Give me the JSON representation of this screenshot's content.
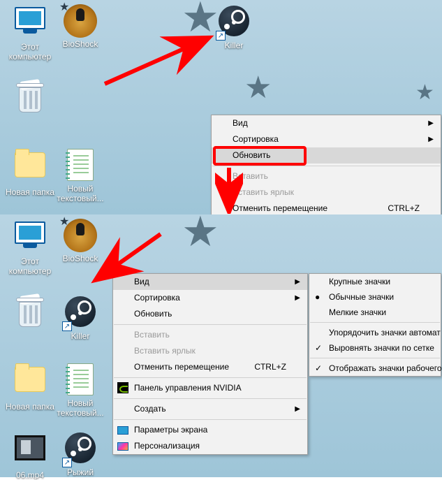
{
  "top": {
    "icons": {
      "pc": "Этот компьютер",
      "bioshock": "BioShock",
      "killer": "Killer",
      "newfolder": "Новая папка",
      "newtxt": "Новый текстовый..."
    },
    "menu": {
      "view": "Вид",
      "sort": "Сортировка",
      "refresh": "Обновить",
      "paste": "Вставить",
      "paste_shortcut": "Вставить ярлык",
      "undo_move": "Отменить перемещение",
      "undo_key": "CTRL+Z"
    }
  },
  "bottom": {
    "icons": {
      "pc": "Этот компьютер",
      "bioshock": "BioShock",
      "killer": "Killer",
      "newfolder": "Новая папка",
      "newtxt": "Новый текстовый...",
      "video": "06.mp4",
      "ryzhiy": "Рыжий"
    },
    "menu": {
      "view": "Вид",
      "sort": "Сортировка",
      "refresh": "Обновить",
      "paste": "Вставить",
      "paste_shortcut": "Вставить ярлык",
      "undo_move": "Отменить перемещение",
      "undo_key": "CTRL+Z",
      "nvidia": "Панель управления NVIDIA",
      "new": "Создать",
      "display": "Параметры экрана",
      "personalize": "Персонализация"
    },
    "submenu": {
      "large": "Крупные значки",
      "medium": "Обычные значки",
      "small": "Мелкие значки",
      "auto": "Упорядочить значки автомат",
      "grid": "Выровнять значки по сетке",
      "show": "Отображать значки рабочего"
    }
  }
}
